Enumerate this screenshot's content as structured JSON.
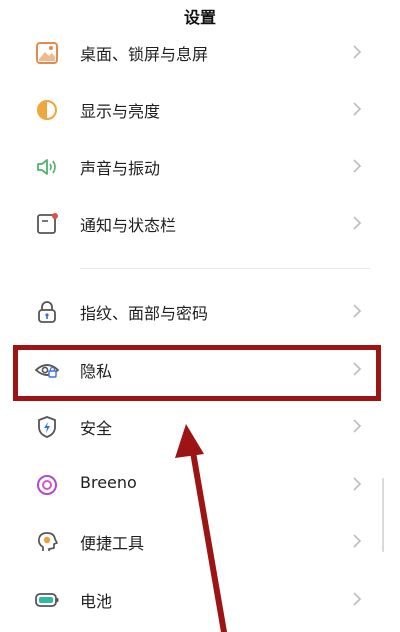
{
  "header": {
    "title": "设置"
  },
  "settings": {
    "items": [
      {
        "label": "桌面、锁屏与息屏",
        "icon": "wallpaper-icon",
        "icon_color": "#e58a4b"
      },
      {
        "label": "显示与亮度",
        "icon": "brightness-icon",
        "icon_color": "#f0a63a"
      },
      {
        "label": "声音与振动",
        "icon": "speaker-icon",
        "icon_color": "#4fb36b"
      },
      {
        "label": "通知与状态栏",
        "icon": "notification-icon",
        "icon_color": "#e0504a"
      },
      {
        "label": "指纹、面部与密码",
        "icon": "lock-icon",
        "icon_color": "#3d6fd6"
      },
      {
        "label": "隐私",
        "icon": "privacy-eye-icon",
        "icon_color": "#3a73d8"
      },
      {
        "label": "安全",
        "icon": "shield-icon",
        "icon_color": "#3a73d8"
      },
      {
        "label": "Breeno",
        "icon": "breeno-icon",
        "icon_color": "#b04ad0"
      },
      {
        "label": "便捷工具",
        "icon": "tools-icon",
        "icon_color": "#e6a33a"
      },
      {
        "label": "电池",
        "icon": "battery-icon",
        "icon_color": "#2fb8a3"
      }
    ]
  },
  "annotation": {
    "highlight_color": "#9c1414"
  }
}
